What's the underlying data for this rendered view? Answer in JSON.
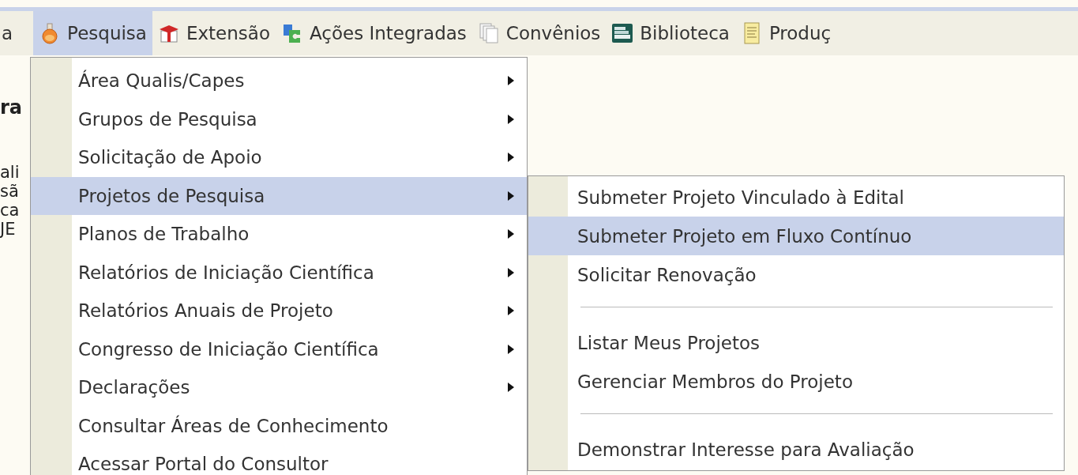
{
  "menubar": [
    {
      "label": "a",
      "selected": false
    },
    {
      "label": "Pesquisa",
      "selected": true
    },
    {
      "label": "Extensão",
      "selected": false
    },
    {
      "label": "Ações Integradas",
      "selected": false
    },
    {
      "label": "Convênios",
      "selected": false
    },
    {
      "label": "Biblioteca",
      "selected": false
    },
    {
      "label": "Produç",
      "selected": false
    }
  ],
  "background_text": {
    "side_fragments": [
      "ra",
      "ali",
      "sã",
      "ca",
      "JE"
    ]
  },
  "menu": [
    {
      "label": "Área Qualis/Capes",
      "kind": "submenu",
      "selected": false
    },
    {
      "label": "Grupos de Pesquisa",
      "kind": "submenu",
      "selected": false
    },
    {
      "label": "Solicitação de Apoio",
      "kind": "submenu",
      "selected": false
    },
    {
      "label": "Projetos de Pesquisa",
      "kind": "submenu",
      "selected": true
    },
    {
      "label": "Planos de Trabalho",
      "kind": "submenu",
      "selected": false
    },
    {
      "label": "Relatórios de Iniciação Científica",
      "kind": "submenu",
      "selected": false
    },
    {
      "label": "Relatórios Anuais de Projeto",
      "kind": "submenu",
      "selected": false
    },
    {
      "label": "Congresso de Iniciação Científica",
      "kind": "submenu",
      "selected": false
    },
    {
      "label": "Declarações",
      "kind": "submenu",
      "selected": false
    },
    {
      "label": "Consultar Áreas de Conhecimento",
      "kind": "item",
      "selected": false
    },
    {
      "label": "Acessar Portal do Consultor",
      "kind": "item",
      "selected": false
    }
  ],
  "submenu": [
    {
      "label": "Submeter Projeto Vinculado à Edital",
      "kind": "item",
      "selected": false
    },
    {
      "label": "Submeter Projeto em Fluxo Contínuo",
      "kind": "item",
      "selected": true
    },
    {
      "label": "Solicitar Renovação",
      "kind": "item",
      "selected": false
    },
    {
      "kind": "separator"
    },
    {
      "label": "Listar Meus Projetos",
      "kind": "item",
      "selected": false
    },
    {
      "label": "Gerenciar Membros do Projeto",
      "kind": "item",
      "selected": false
    },
    {
      "kind": "separator"
    },
    {
      "label": "Demonstrar Interesse para Avaliação",
      "kind": "item",
      "selected": false
    }
  ]
}
